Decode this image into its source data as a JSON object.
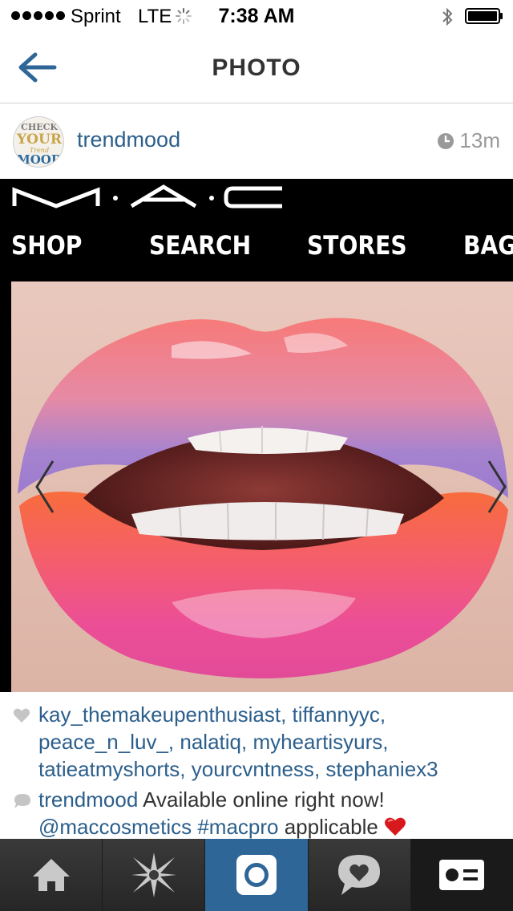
{
  "status_bar": {
    "carrier": "Sprint",
    "network": "LTE",
    "time": "7:38 AM"
  },
  "header": {
    "title": "PHOTO"
  },
  "post": {
    "avatar_text": [
      "CHECK",
      "YOUR",
      "Trend",
      "MOOD"
    ],
    "username": "trendmood",
    "time_ago": "13m",
    "photo": {
      "brand_logo": "M·A·C",
      "nav": [
        "SHOP",
        "SEARCH",
        "STORES",
        "BAG"
      ]
    },
    "likes": {
      "users": [
        "kay_themakeupenthusiast",
        "tiffannyyc",
        "peace_n_luv_",
        "nalatiq",
        "myheartisyurs",
        "tatieatmyshorts",
        "yourcvntness",
        "stephaniex3"
      ]
    },
    "caption": {
      "author": "trendmood",
      "text_1": "Available online right now!",
      "mention": "@maccosmetics",
      "hashtag": "#macpro",
      "text_2": "applicable",
      "emoji": "red-heart"
    }
  },
  "tab_bar": {
    "items": [
      "home-icon",
      "explore-star-icon",
      "camera-icon",
      "activity-heart-icon",
      "profile-card-icon"
    ],
    "active_index": 2
  },
  "colors": {
    "link_blue": "#2c5f8c",
    "tab_active": "#2f6698",
    "tab_bg": "#2b2b2b"
  }
}
